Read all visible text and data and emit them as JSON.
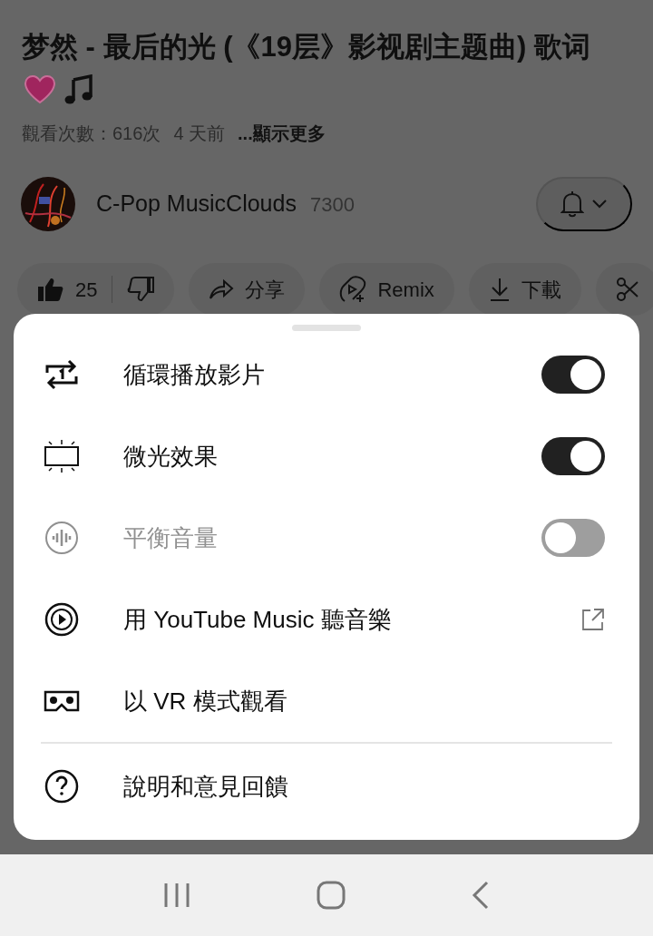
{
  "video": {
    "title": "梦然 - 最后的光 (《19层》影视剧主题曲) 歌词",
    "views": "觀看次數：616次",
    "age": "4 天前",
    "more": "...顯示更多"
  },
  "channel": {
    "name": "C-Pop MusicClouds",
    "subscribers": "7300"
  },
  "actions": [
    {
      "kind": "like",
      "label": "25"
    },
    {
      "kind": "share",
      "label": "分享"
    },
    {
      "kind": "remix",
      "label": "Remix"
    },
    {
      "kind": "download",
      "label": "下載"
    },
    {
      "kind": "clip"
    }
  ],
  "menu": [
    {
      "kind": "toggle",
      "label": "循環播放影片",
      "on": true,
      "disabled": false
    },
    {
      "kind": "toggle",
      "label": "微光效果",
      "on": true,
      "disabled": false
    },
    {
      "kind": "toggle",
      "label": "平衡音量",
      "on": false,
      "disabled": true
    },
    {
      "kind": "external",
      "label": "用 YouTube Music 聽音樂"
    },
    {
      "kind": "plain",
      "label": "以 VR 模式觀看"
    }
  ],
  "footer_item": {
    "label": "說明和意見回饋"
  }
}
